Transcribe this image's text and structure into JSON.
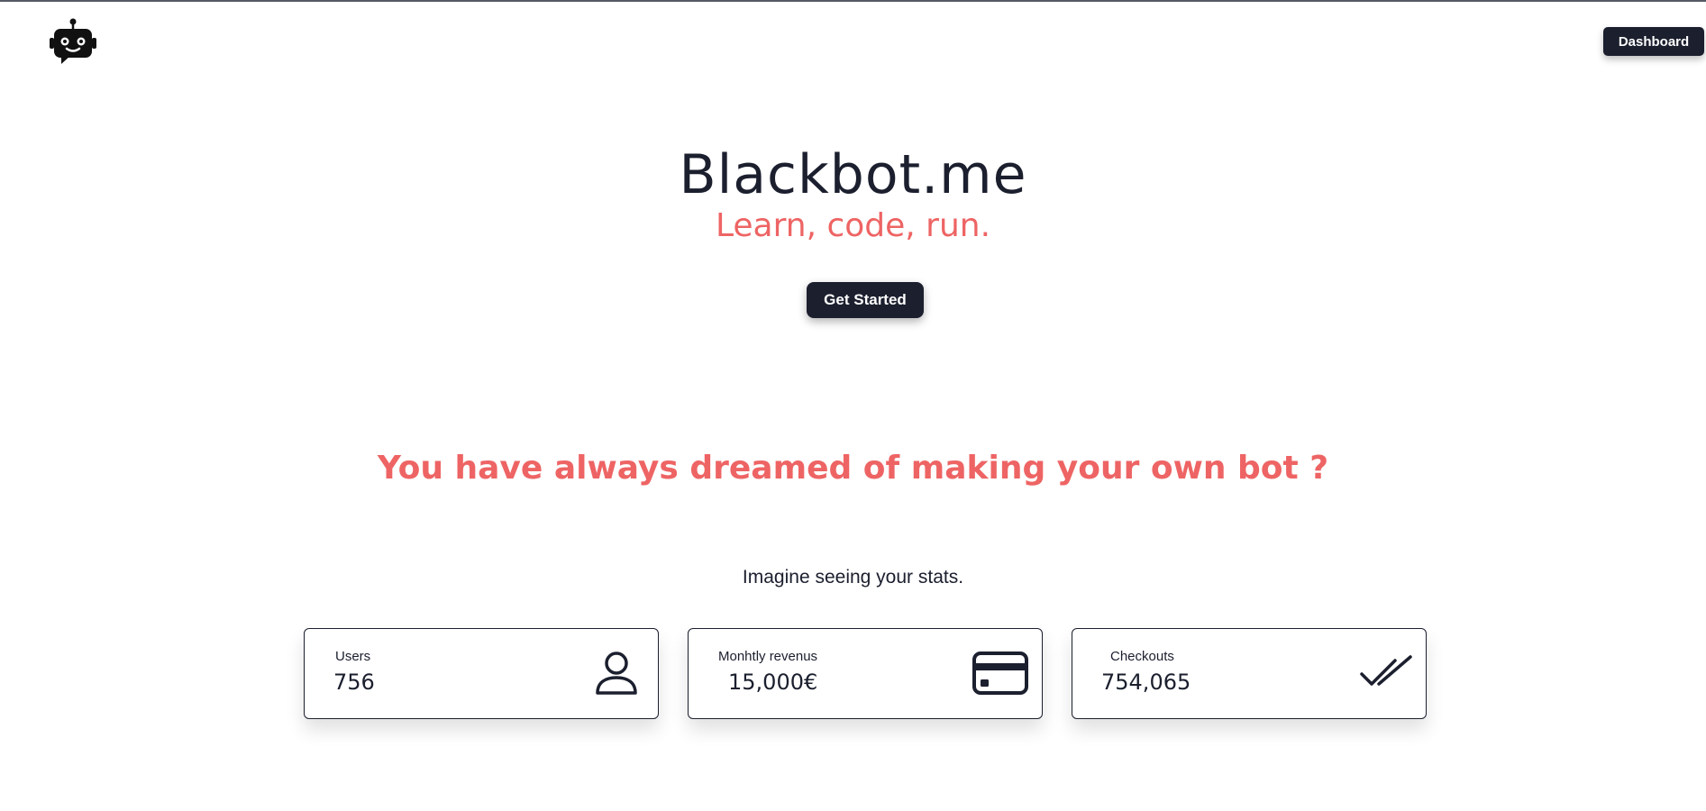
{
  "header": {
    "logo_icon": "robot-chat-icon",
    "dashboard_label": "Dashboard"
  },
  "hero": {
    "title": "Blackbot.me",
    "subtitle": "Learn, code, run.",
    "cta_label": "Get Started"
  },
  "pitch": {
    "headline": "You have always dreamed of making your own bot ?",
    "intro": "Imagine seeing your stats."
  },
  "stats": [
    {
      "label": "Users",
      "value": "756",
      "icon": "user-icon"
    },
    {
      "label": "Monhtly revenus",
      "value": "15,000€",
      "icon": "credit-card-icon"
    },
    {
      "label": "Checkouts",
      "value": "754,065",
      "icon": "double-check-icon"
    }
  ],
  "colors": {
    "primary_dark": "#1b1f2e",
    "accent_coral": "#ee6464",
    "background": "#ffffff"
  }
}
